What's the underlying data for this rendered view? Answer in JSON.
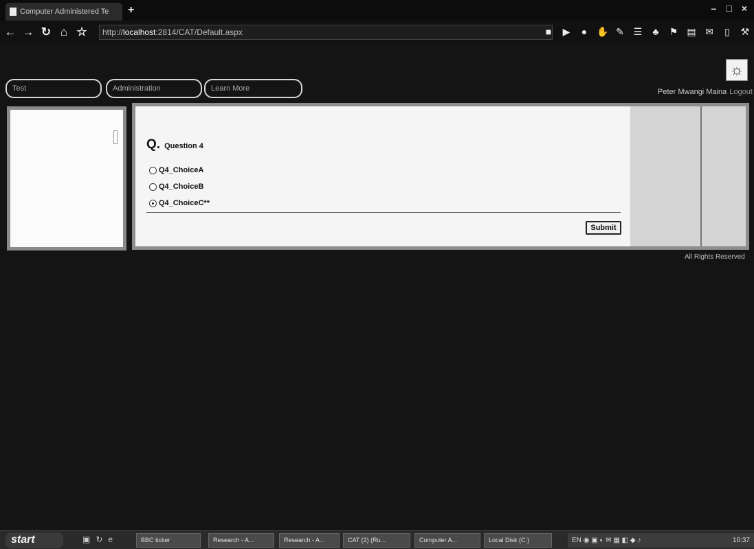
{
  "browser": {
    "tab_title": "Computer Administered Te",
    "new_tab": "+",
    "url_prefix": "http://",
    "url_host": "localhost",
    "url_path": ":2814/CAT/Default.aspx",
    "window_controls": {
      "minimize": "–",
      "maximize": "□",
      "close": "×"
    }
  },
  "nav": {
    "items": [
      {
        "label": "Test"
      },
      {
        "label": "Administration"
      },
      {
        "label": "Learn More"
      }
    ]
  },
  "user": {
    "name": "Peter Mwangi Maina",
    "logout": "Logout"
  },
  "question": {
    "marker": "Q.",
    "title": "Question 4",
    "choices": [
      {
        "label": "Q4_ChoiceA",
        "selected": false
      },
      {
        "label": "Q4_ChoiceB",
        "selected": false
      },
      {
        "label": "Q4_ChoiceC**",
        "selected": true
      }
    ],
    "submit_label": "Submit"
  },
  "footer": {
    "text": "All Rights Reserved"
  },
  "taskbar": {
    "start_label": "start",
    "buttons": [
      {
        "label": "BBC ticker"
      },
      {
        "label": "Research - A..."
      },
      {
        "label": "Research - A..."
      },
      {
        "label": "CAT (2) (Ru..."
      },
      {
        "label": "Computer A..."
      },
      {
        "label": "Local Disk (C:)"
      }
    ],
    "language": "EN",
    "clock": "10:37"
  }
}
